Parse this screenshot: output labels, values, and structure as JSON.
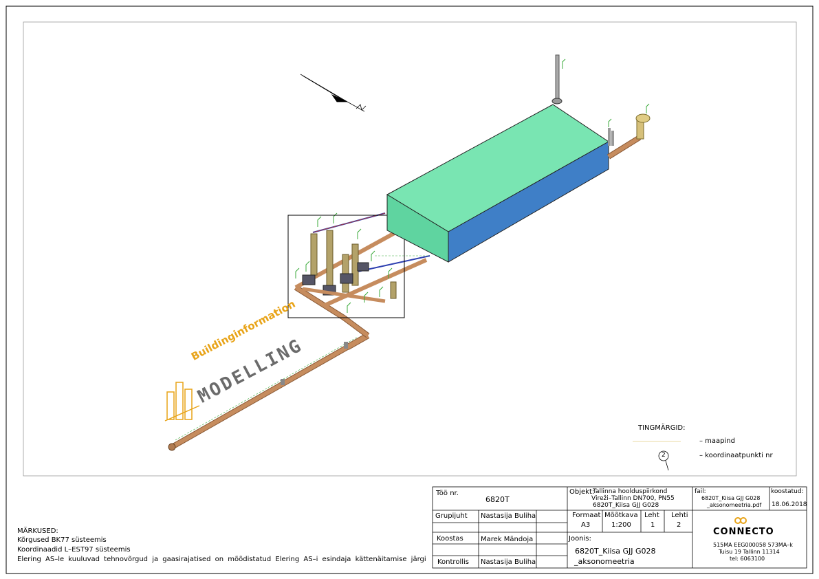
{
  "logo": {
    "line1": "Buildinginformation",
    "line2": "MODELLING"
  },
  "legend": {
    "title": "TINGMÄRGID:",
    "marker_label": "2",
    "items": [
      {
        "label": "– maapind"
      },
      {
        "label": "– koordinaatpunkti nr"
      }
    ]
  },
  "notes": {
    "heading": "MÄRKUSED:",
    "lines": [
      "Kõrgused BK77 süsteemis",
      "Koordinaadid L–EST97 süsteemis",
      "Elering AS–le kuuluvad tehnovõrgud ja gaasirajatised on mõõdistatud Elering AS–i esindaja kättenäitamise järgi"
    ]
  },
  "title_block": {
    "job_label": "Töö nr.",
    "job_number": "6820T",
    "group_lead_label": "Grupijuht",
    "group_lead": "Nastasija Buliha",
    "author_label": "Koostas",
    "author": "Marek Mändoja",
    "checker_label": "Kontrollis",
    "checker": "Nastasija Buliha",
    "object_label": "Objekt:",
    "object_lines": [
      "Tallinna hoolduspiirkond",
      "Vireži–Tallinn DN700, PN55",
      "6820T_Kiisa GJJ G028"
    ],
    "file_label": "fail:",
    "file_lines": [
      "6820T_Kiisa GJJ G028",
      "_aksonomeetria.pdf"
    ],
    "date_label": "koostatud:",
    "date": "18.06.2018",
    "format_label": "Formaat",
    "format": "A3",
    "scale_label": "Mõõtkava",
    "scale": "1:200",
    "sheet_label": "Leht",
    "sheet": "1",
    "sheets_label": "Lehti",
    "sheets": "2",
    "drawing_label": "Joonis:",
    "drawing_lines": [
      "6820T_Kiisa GJJ G028",
      "_aksonomeetria"
    ],
    "company": "CONNECTO",
    "company_lines": [
      "515MA EEG000058 573MA–k",
      "Tuisu 19 Tallinn 11314",
      "tel: 6063100"
    ]
  },
  "colors": {
    "pipe": "#c68c5e",
    "pipe_dark": "#8a5a36",
    "box_top": "#79e5b2",
    "box_front": "#5fd4a0",
    "box_side": "#3f7fc7",
    "logo_orange": "#e8a317",
    "logo_gray": "#6b6b6b",
    "accent_green": "#3aaa3a",
    "accent_blue": "#2d3fb0",
    "accent_red": "#c0392b"
  }
}
